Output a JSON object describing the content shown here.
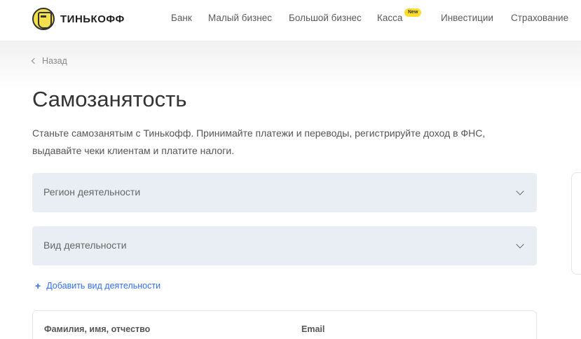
{
  "header": {
    "brand": "ТИНЬКОФФ",
    "nav": [
      {
        "label": "Банк"
      },
      {
        "label": "Малый бизнес"
      },
      {
        "label": "Большой бизнес"
      },
      {
        "label": "Касса"
      },
      {
        "label": "Инвестиции"
      },
      {
        "label": "Страхование"
      }
    ],
    "new_badge": "New"
  },
  "main": {
    "back_label": "Назад",
    "title": "Самозанятость",
    "description_line1": "Станьте самозанятым с Тинькофф. Принимайте платежи и переводы, регистрируйте доход в ФНС,",
    "description_line2": "выдавайте чеки клиентам и платите налоги.",
    "region_placeholder": "Регион деятельности",
    "activity_placeholder": "Вид деятельности",
    "add_activity": "Добавить вид деятельности",
    "form": {
      "fio_label": "Фамилия, имя, отчество",
      "email_label": "Email"
    }
  },
  "colors": {
    "accent": "#336fee",
    "brand_yellow": "#ffdd2d",
    "field_bg": "#e9eef4"
  }
}
